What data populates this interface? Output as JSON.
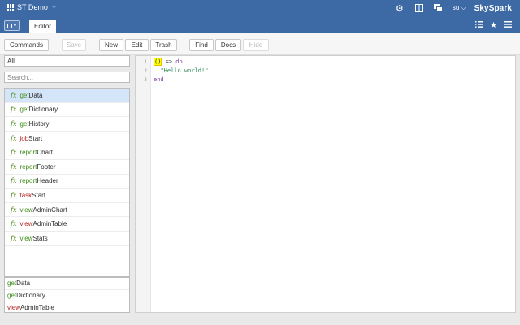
{
  "topbar": {
    "project_name": "ST Demo",
    "user": "su",
    "brand": "SkySpark",
    "icons": [
      "gear-icon",
      "panel-icon",
      "windows-icon"
    ]
  },
  "tabbar": {
    "active_tab": "Editor",
    "right_icons": [
      "list-icon",
      "star-icon",
      "hamburger-icon"
    ]
  },
  "toolbar": {
    "commands": "Commands",
    "save": "Save",
    "new": "New",
    "edit": "Edit",
    "trash": "Trash",
    "find": "Find",
    "docs": "Docs",
    "hide": "Hide"
  },
  "filter": {
    "selected": "All",
    "search_placeholder": "Search..."
  },
  "functions": [
    {
      "a": "get",
      "b": "Data",
      "red": false
    },
    {
      "a": "get",
      "b": "Dictionary",
      "red": false
    },
    {
      "a": "get",
      "b": "History",
      "red": false
    },
    {
      "a": "job",
      "b": "Start",
      "red": true
    },
    {
      "a": "report",
      "b": "Chart",
      "red": false
    },
    {
      "a": "report",
      "b": "Footer",
      "red": false
    },
    {
      "a": "report",
      "b": "Header",
      "red": false
    },
    {
      "a": "task",
      "b": "Start",
      "red": true
    },
    {
      "a": "view",
      "b": "AdminChart",
      "red": false
    },
    {
      "a": "view",
      "b": "AdminTable",
      "red": true
    },
    {
      "a": "view",
      "b": "Stats",
      "red": false
    }
  ],
  "fx_symbol": "fx",
  "recent": [
    {
      "a": "get",
      "b": "Data",
      "red": false
    },
    {
      "a": "get",
      "b": "Dictionary",
      "red": false
    },
    {
      "a": "view",
      "b": "AdminTable",
      "red": true
    }
  ],
  "editor": {
    "line_numbers": [
      "1",
      "2",
      "3"
    ],
    "line1_parens": "()",
    "line1_arrow": " => ",
    "line1_do": "do",
    "line2_indent": "  ",
    "line2_string": "\"Hello world!\"",
    "line3": "end"
  }
}
